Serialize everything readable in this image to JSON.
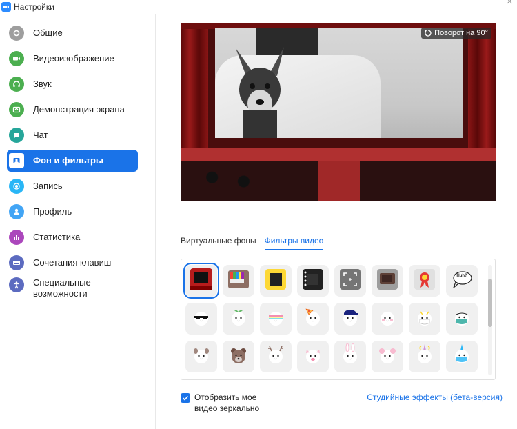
{
  "window": {
    "title": "Настройки"
  },
  "sidebar": {
    "items": [
      {
        "label": "Общие",
        "icon": "gear-icon",
        "color": "#9e9e9e",
        "active": false
      },
      {
        "label": "Видеоизображение",
        "icon": "video-camera-icon",
        "color": "#4caf50",
        "active": false
      },
      {
        "label": "Звук",
        "icon": "headphones-icon",
        "color": "#4caf50",
        "active": false
      },
      {
        "label": "Демонстрация экрана",
        "icon": "share-screen-icon",
        "color": "#4caf50",
        "active": false
      },
      {
        "label": "Чат",
        "icon": "chat-bubble-icon",
        "color": "#26a69a",
        "active": false
      },
      {
        "label": "Фон и фильтры",
        "icon": "background-icon",
        "color": "#ffffff",
        "active": true
      },
      {
        "label": "Запись",
        "icon": "record-icon",
        "color": "#29b6f6",
        "active": false
      },
      {
        "label": "Профиль",
        "icon": "person-icon",
        "color": "#42a5f5",
        "active": false
      },
      {
        "label": "Статистика",
        "icon": "bar-chart-icon",
        "color": "#ab47bc",
        "active": false
      },
      {
        "label": "Сочетания клавиш",
        "icon": "keyboard-icon",
        "color": "#5c6bc0",
        "active": false
      },
      {
        "label": "Специальные возможности",
        "icon": "accessibility-icon",
        "color": "#5c6bc0",
        "active": false
      }
    ]
  },
  "preview": {
    "rotate_label": "Поворот на 90°"
  },
  "tabs": [
    {
      "label": "Виртуальные фоны",
      "active": false
    },
    {
      "label": "Фильтры видео",
      "active": true
    }
  ],
  "filters": [
    {
      "icon": "theater-curtain-icon",
      "selected": true
    },
    {
      "icon": "tv-color-bars-icon",
      "selected": false
    },
    {
      "icon": "emoji-frame-icon",
      "selected": false
    },
    {
      "icon": "film-strip-icon",
      "selected": false
    },
    {
      "icon": "camera-focus-frame-icon",
      "selected": false
    },
    {
      "icon": "retro-tv-icon",
      "selected": false
    },
    {
      "icon": "award-ribbon-icon",
      "selected": false
    },
    {
      "icon": "speech-bubble-huh-icon",
      "selected": false
    },
    {
      "icon": "pixel-sunglasses-icon",
      "selected": false
    },
    {
      "icon": "sprout-face-icon",
      "selected": false
    },
    {
      "icon": "rainbow-face-icon",
      "selected": false
    },
    {
      "icon": "pizza-hat-face-icon",
      "selected": false
    },
    {
      "icon": "cap-face-icon",
      "selected": false
    },
    {
      "icon": "blush-face-icon",
      "selected": false
    },
    {
      "icon": "white-mask-face-icon",
      "selected": false
    },
    {
      "icon": "medical-mask-face-icon",
      "selected": false
    },
    {
      "icon": "puppy-face-icon",
      "selected": false
    },
    {
      "icon": "bear-face-icon",
      "selected": false
    },
    {
      "icon": "reindeer-face-icon",
      "selected": false
    },
    {
      "icon": "pig-face-icon",
      "selected": false
    },
    {
      "icon": "bunny-face-icon",
      "selected": false
    },
    {
      "icon": "mouse-face-icon",
      "selected": false
    },
    {
      "icon": "unicorn-face-icon",
      "selected": false
    },
    {
      "icon": "unicorn-mask-face-icon",
      "selected": false
    }
  ],
  "speech_bubble_text": "Huh?",
  "footer": {
    "mirror_label": "Отобразить мое видео зеркально",
    "mirror_checked": true,
    "studio_link": "Студийные эффекты (бета-версия)"
  }
}
